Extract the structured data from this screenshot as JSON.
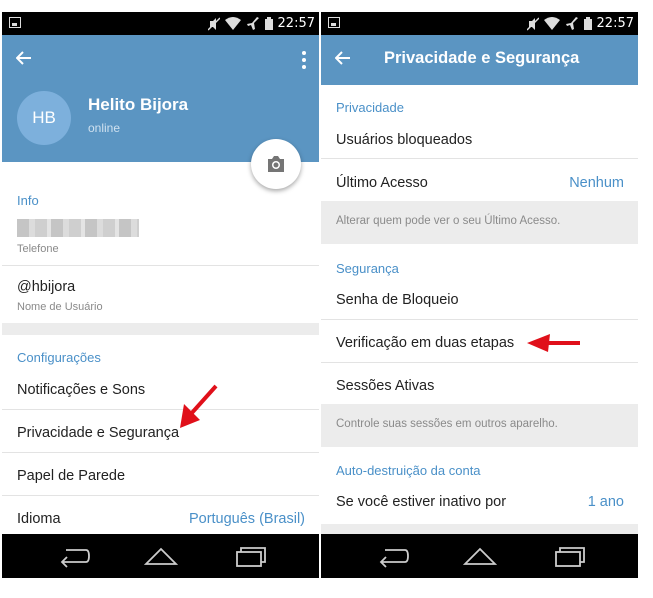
{
  "status_bar": {
    "time": "22:57"
  },
  "left_screen": {
    "profile": {
      "initials": "HB",
      "name": "Helito Bijora",
      "status": "online"
    },
    "info": {
      "section_title": "Info",
      "phone_caption": "Telefone",
      "username": "@hbijora",
      "username_caption": "Nome de Usuário"
    },
    "settings": {
      "section_title": "Configurações",
      "items": [
        {
          "label": "Notificações e Sons"
        },
        {
          "label": "Privacidade e Segurança"
        },
        {
          "label": "Papel de Parede"
        },
        {
          "label": "Idioma",
          "value": "Português (Brasil)"
        }
      ]
    }
  },
  "right_screen": {
    "title": "Privacidade e Segurança",
    "privacy": {
      "section_title": "Privacidade",
      "blocked_users": "Usuários bloqueados",
      "last_seen": "Último Acesso",
      "last_seen_value": "Nenhum",
      "hint": "Alterar quem pode ver o seu Último Acesso."
    },
    "security": {
      "section_title": "Segurança",
      "passcode": "Senha de Bloqueio",
      "two_step": "Verificação em duas etapas",
      "sessions": "Sessões Ativas",
      "hint": "Controle suas sessões em outros aparelho."
    },
    "self_destruct": {
      "section_title": "Auto-destruição da conta",
      "inactive_label": "Se você estiver inativo por",
      "inactive_value": "1 ano"
    }
  },
  "colors": {
    "header": "#5b95c2",
    "accent": "#4a90c8",
    "arrow": "#e0101a"
  }
}
